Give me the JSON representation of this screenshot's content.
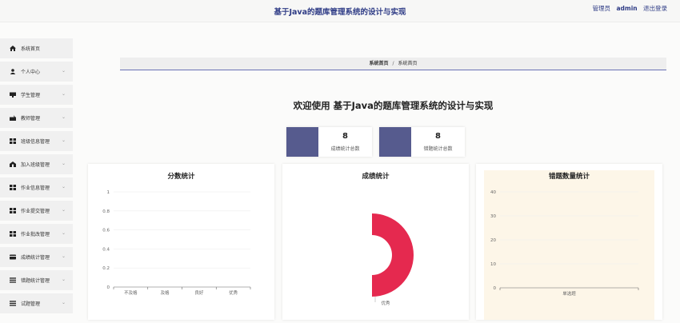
{
  "header": {
    "title": "基于Java的题库管理系统的设计与实现",
    "role": "管理员",
    "username": "admin",
    "logout": "退出登录"
  },
  "sidebar": {
    "items": [
      {
        "label": "系统首页",
        "icon": "home-icon"
      },
      {
        "label": "个人中心",
        "icon": "user-icon"
      },
      {
        "label": "学生管理",
        "icon": "student-icon"
      },
      {
        "label": "教师管理",
        "icon": "teacher-icon"
      },
      {
        "label": "班级信息管理",
        "icon": "grid-icon"
      },
      {
        "label": "加入班级管理",
        "icon": "join-icon"
      },
      {
        "label": "作业信息管理",
        "icon": "grid-icon"
      },
      {
        "label": "作业提交管理",
        "icon": "grid-icon"
      },
      {
        "label": "作业批改管理",
        "icon": "grid-icon"
      },
      {
        "label": "成绩统计管理",
        "icon": "card-icon"
      },
      {
        "label": "错题统计管理",
        "icon": "list-icon"
      },
      {
        "label": "试题管理",
        "icon": "list-icon"
      }
    ]
  },
  "breadcrumb": {
    "home": "系统首页",
    "separator": "/",
    "current": "系统首页"
  },
  "welcome": "欢迎使用 基于Java的题库管理系统的设计与实现",
  "stats": [
    {
      "value": "8",
      "label": "成绩统计总数"
    },
    {
      "value": "8",
      "label": "错题统计总数"
    }
  ],
  "colors": {
    "accent": "#2f3c86",
    "statBlock": "#565b8e",
    "pie": "#e5294f",
    "crumbLine": "#6a72b4"
  },
  "charts": {
    "score": {
      "title": "分数统计"
    },
    "grade": {
      "title": "成绩统计"
    },
    "wrong": {
      "title": "错题数量统计"
    }
  },
  "chart_data": [
    {
      "type": "bar",
      "title": "分数统计",
      "categories": [
        "不及格",
        "及格",
        "良好",
        "优秀"
      ],
      "values": [
        0,
        0,
        0,
        0
      ],
      "yticks": [
        "0",
        "0.2",
        "0.4",
        "0.6",
        "0.8",
        "1"
      ],
      "ylim": [
        0,
        1
      ],
      "grid": true
    },
    {
      "type": "pie",
      "title": "成绩统计",
      "slices": [
        {
          "label": "优秀",
          "value": 1
        }
      ],
      "rose": true
    },
    {
      "type": "bar",
      "title": "错题数量统计",
      "categories": [
        "单选题"
      ],
      "values": [
        0
      ],
      "yticks": [
        "0",
        "10",
        "20",
        "30",
        "40"
      ],
      "ylim": [
        0,
        40
      ],
      "grid": true
    }
  ]
}
